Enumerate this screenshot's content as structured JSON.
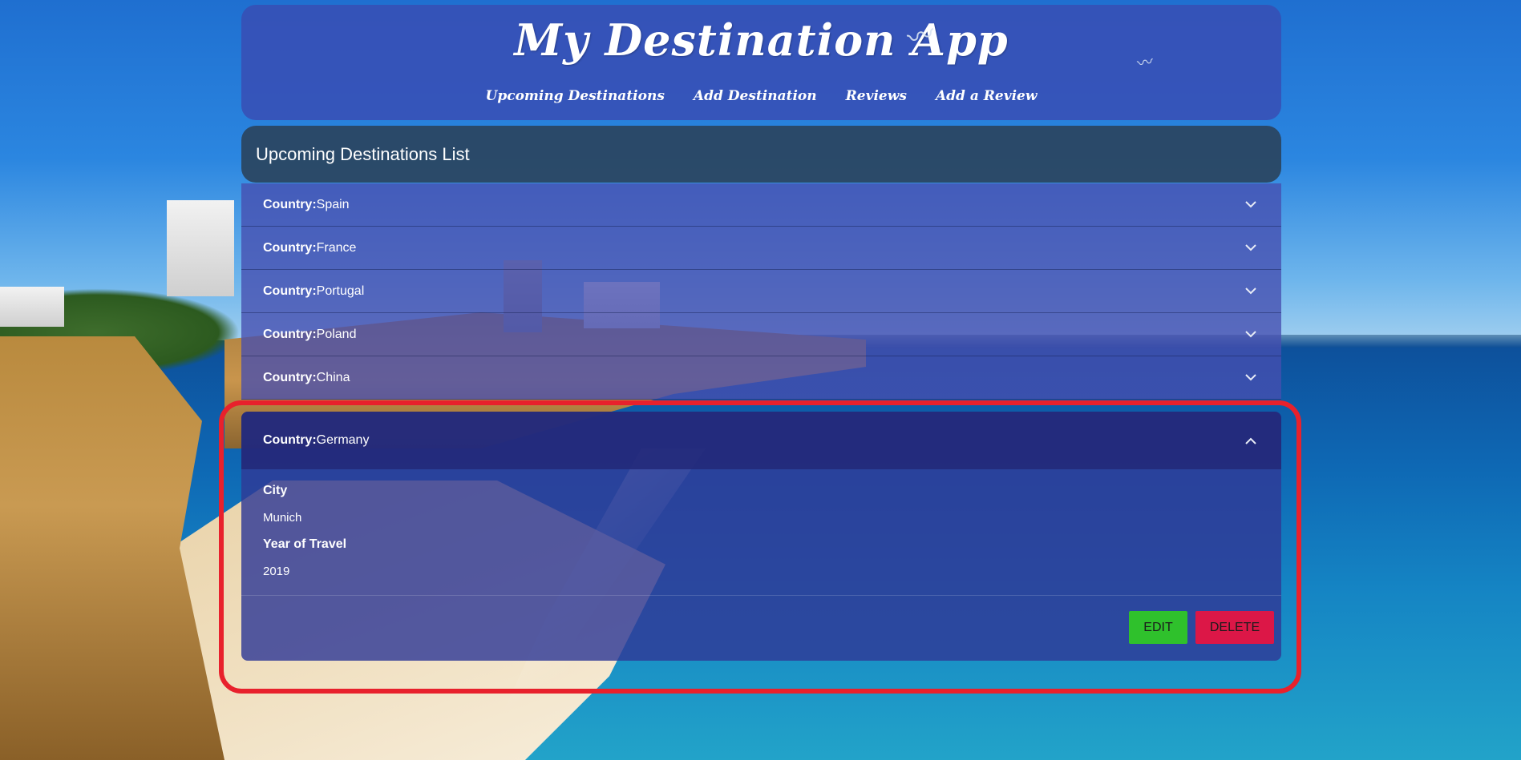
{
  "app": {
    "title": "My Destination App"
  },
  "nav": [
    {
      "label": "Upcoming Destinations"
    },
    {
      "label": "Add Destination"
    },
    {
      "label": "Reviews"
    },
    {
      "label": "Add a Review"
    }
  ],
  "list": {
    "title": "Upcoming Destinations List",
    "field_prefix": "Country:",
    "items": [
      {
        "country": "Spain"
      },
      {
        "country": "France"
      },
      {
        "country": "Portugal"
      },
      {
        "country": "Poland"
      },
      {
        "country": "China"
      }
    ],
    "expanded": {
      "country": "Germany",
      "city_label": "City",
      "city": "Munich",
      "year_label": "Year of Travel",
      "year": "2019",
      "edit_label": "EDIT",
      "delete_label": "DELETE"
    }
  },
  "colors": {
    "edit_button": "#2fc12c",
    "delete_button": "#dc1747",
    "highlight_border": "#e8212c"
  },
  "icons": {
    "collapsed": "chevron-down-icon",
    "expanded": "chevron-up-icon"
  }
}
